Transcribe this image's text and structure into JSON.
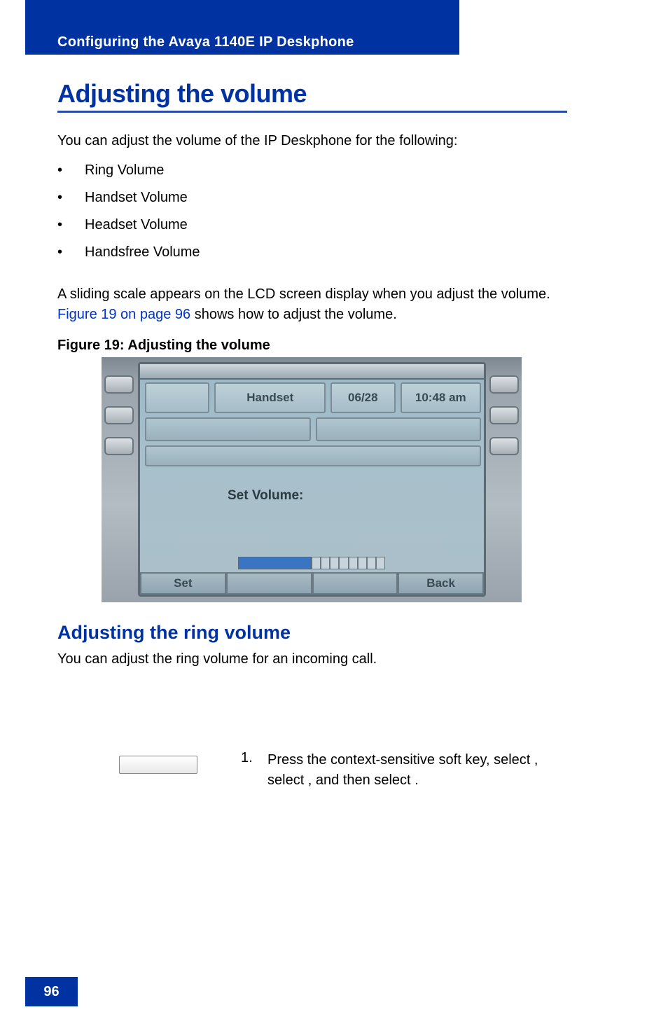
{
  "header": {
    "section_title": "Configuring the Avaya 1140E IP Deskphone"
  },
  "main": {
    "title": "Adjusting the volume",
    "intro": "You can adjust the volume of the IP Deskphone for the following:",
    "bullets": [
      "Ring Volume",
      "Handset Volume",
      "Headset Volume",
      "Handsfree Volume"
    ],
    "scale_text_before_link": "A sliding scale appears on the LCD screen display when you adjust the volume. ",
    "scale_link": "Figure 19 on page 96",
    "scale_text_after_link": " shows how to adjust the volume.",
    "figure_label": "Figure 19: Adjusting the volume"
  },
  "phone_screen": {
    "handset_label": "Handset",
    "date": "06/28",
    "time": "10:48 am",
    "set_volume_label": "Set Volume:",
    "softkeys": [
      "Set",
      "",
      "",
      "Back"
    ]
  },
  "sub": {
    "heading": "Adjusting the ring volume",
    "text": "You can adjust the ring volume for an incoming call."
  },
  "step": {
    "number": "1.",
    "line": "Press the          context-sensitive soft key, select              , select            , and then select                           ."
  },
  "page_number": "96"
}
